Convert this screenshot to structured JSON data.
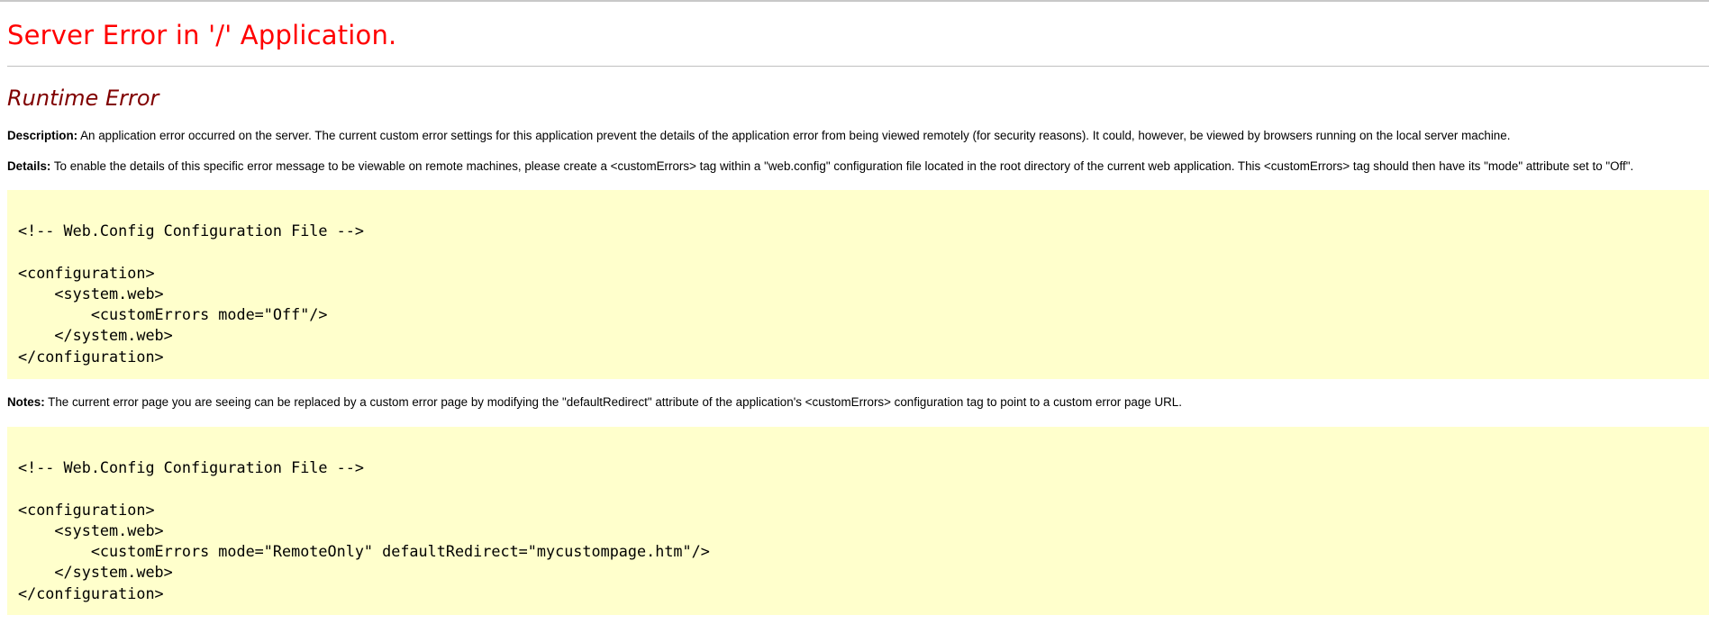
{
  "header": {
    "title": "Server Error in '/' Application.",
    "subtitle": "Runtime Error"
  },
  "description": {
    "label": "Description:",
    "text": " An application error occurred on the server. The current custom error settings for this application prevent the details of the application error from being viewed remotely (for security reasons). It could, however, be viewed by browsers running on the local server machine."
  },
  "details": {
    "label": "Details:",
    "text": " To enable the details of this specific error message to be viewable on remote machines, please create a <customErrors> tag within a \"web.config\" configuration file located in the root directory of the current web application. This <customErrors> tag should then have its \"mode\" attribute set to \"Off\"."
  },
  "code1": {
    "lines": [
      "<!-- Web.Config Configuration File -->",
      "",
      "<configuration>",
      "    <system.web>",
      "        <customErrors mode=\"Off\"/>",
      "    </system.web>",
      "</configuration>"
    ]
  },
  "notes": {
    "label": "Notes:",
    "text": " The current error page you are seeing can be replaced by a custom error page by modifying the \"defaultRedirect\" attribute of the application's <customErrors> configuration tag to point to a custom error page URL."
  },
  "code2": {
    "lines": [
      "<!-- Web.Config Configuration File -->",
      "",
      "<configuration>",
      "    <system.web>",
      "        <customErrors mode=\"RemoteOnly\" defaultRedirect=\"mycustompage.htm\"/>",
      "    </system.web>",
      "</configuration>"
    ]
  },
  "colors": {
    "title": "#ff0000",
    "subtitle": "#800000",
    "code_background": "#ffffcc"
  }
}
